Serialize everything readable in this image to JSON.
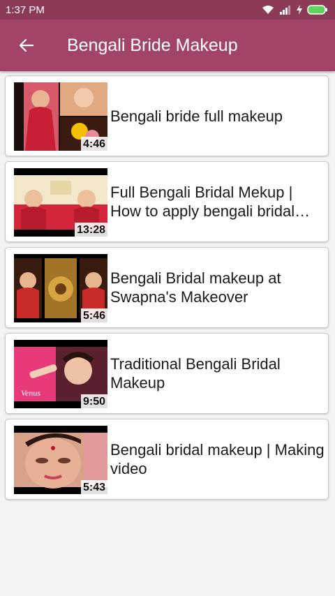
{
  "status_bar": {
    "time": "1:37 PM",
    "icons": [
      "wifi-icon",
      "signal-icon",
      "charging-icon",
      "battery-icon"
    ],
    "color": "#8c3a58"
  },
  "app_bar": {
    "title": "Bengali Bride Makeup",
    "back_icon": "arrow-left-icon",
    "color": "#a24469"
  },
  "videos": [
    {
      "title": "Bengali bride full makeup",
      "duration": "4:46"
    },
    {
      "title": "Full Bengali Bridal Mekup | How to apply bengali bridal makeup",
      "duration": "13:28"
    },
    {
      "title": "Bengali Bridal makeup at Swapna's Makeover",
      "duration": "5:46"
    },
    {
      "title": "Traditional Bengali Bridal Makeup",
      "duration": "9:50"
    },
    {
      "title": "Bengali bridal makeup | Making video",
      "duration": "5:43"
    }
  ]
}
